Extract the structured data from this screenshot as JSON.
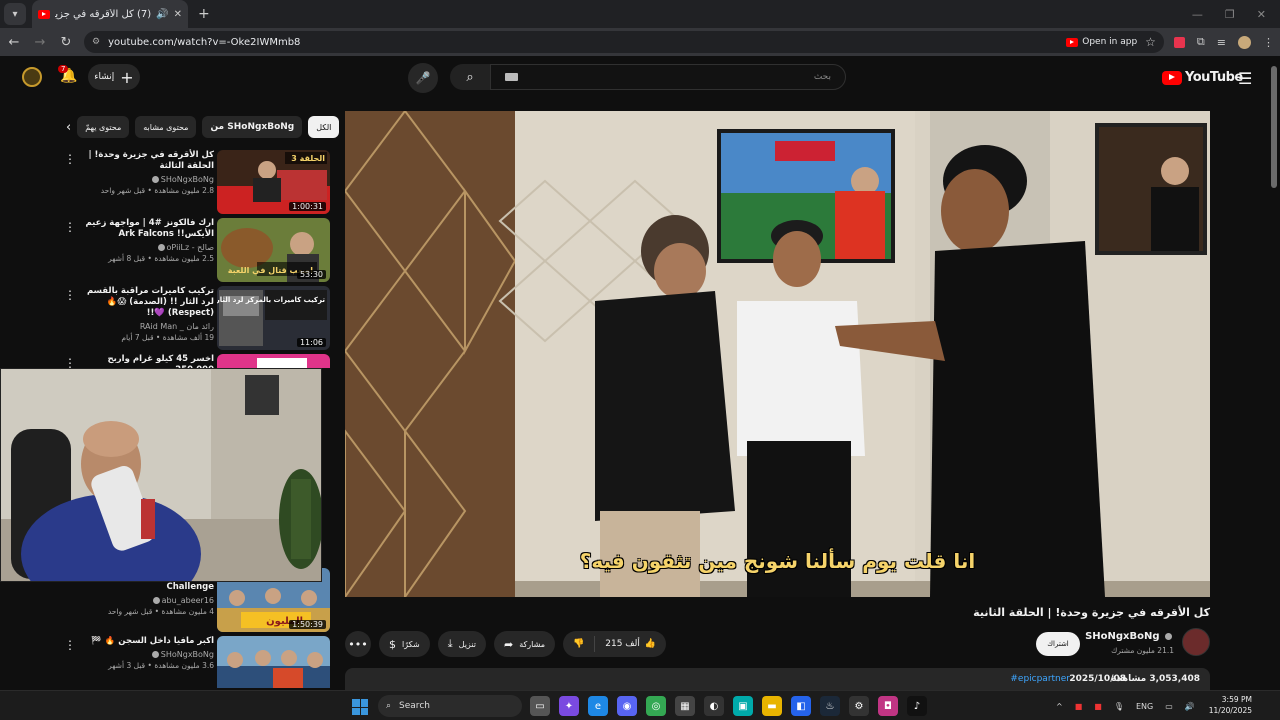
{
  "browser": {
    "tab_title": "(7) كل الأقرقه في جزيرة وحدة!",
    "url": "youtube.com/watch?v=-Oke2IWMmb8",
    "open_in_app": "Open in app"
  },
  "yt_header": {
    "create_label": "إنشاء",
    "notifications_count": "7",
    "search_placeholder": "بحث",
    "logo_text": "YouTube"
  },
  "chips": [
    "الكل",
    "من SHoNgxBoNg",
    "محتوى مشابه",
    "محتوى يهمّ"
  ],
  "recommendations": [
    {
      "title": "كل الأقرقه في جزيرة وحدة! | الحلقة الثالثة",
      "channel": "SHoNgxBoNg",
      "views": "2.8 مليون مشاهدة • قبل شهر واحد",
      "duration": "1:00:31",
      "thumb_text": "الحلقة 3"
    },
    {
      "title": "ارك فالكونز #4 | مواجهة زعيم الأيكس!! Ark Falcons",
      "channel": "صالح - oPiiLz",
      "views": "2.5 مليون مشاهدة • قبل 8 أشهر",
      "duration": "53:30",
      "thumb_text": "اصعب قتال في اللعبة"
    },
    {
      "title": "تركيب كاميرات مراقبة بالقسم لرد الثار !! (الصدمة) 😱🔥 (Respect) 💜!!",
      "channel": "رائد مان _ RAid Man",
      "views": "19 ألف مشاهدة • قبل 7 أيام",
      "duration": "11:06",
      "thumb_text": "تركيب كاميرات بالمركز لرد الثار"
    },
    {
      "title": "اخسر 45 كيلو غرام واربح 250,000",
      "channel": "",
      "views": "",
      "duration": "",
      "thumb_text": ""
    },
    {
      "title": "Challenge",
      "channel": "abu_abeer16",
      "views": "4 مليون مشاهدة • قبل شهر واحد",
      "duration": "1:50:39",
      "thumb_text": "المليون"
    },
    {
      "title": "أكبر مافيا داخل السجن 🔥 🏁",
      "channel": "SHoNgxBoNg",
      "views": "3.6 مليون مشاهدة • قبل 3 أشهر",
      "duration": "",
      "thumb_text": ""
    }
  ],
  "player": {
    "subtitle": "انا قلت يوم سألنا شونج مين تثقون فيه؟"
  },
  "video": {
    "title": "كل الأقرقه في جزيرة وحدة! | الحلقة الثانية",
    "channel": "SHoNgxBoNg",
    "subscribers": "21.1 مليون مشترك",
    "subscribe_label": "اشتراك",
    "likes": "215 ألف",
    "share_label": "مشاركة",
    "download_label": "تنزيل",
    "thanks_label": "شكرًا",
    "views": "3,053,408 مشاهدة",
    "date": "2025/10/08",
    "hashtag": "#epicpartner"
  },
  "taskbar": {
    "search_label": "Search",
    "lang": "ENG",
    "time": "3:59 PM",
    "date": "11/20/2025"
  }
}
